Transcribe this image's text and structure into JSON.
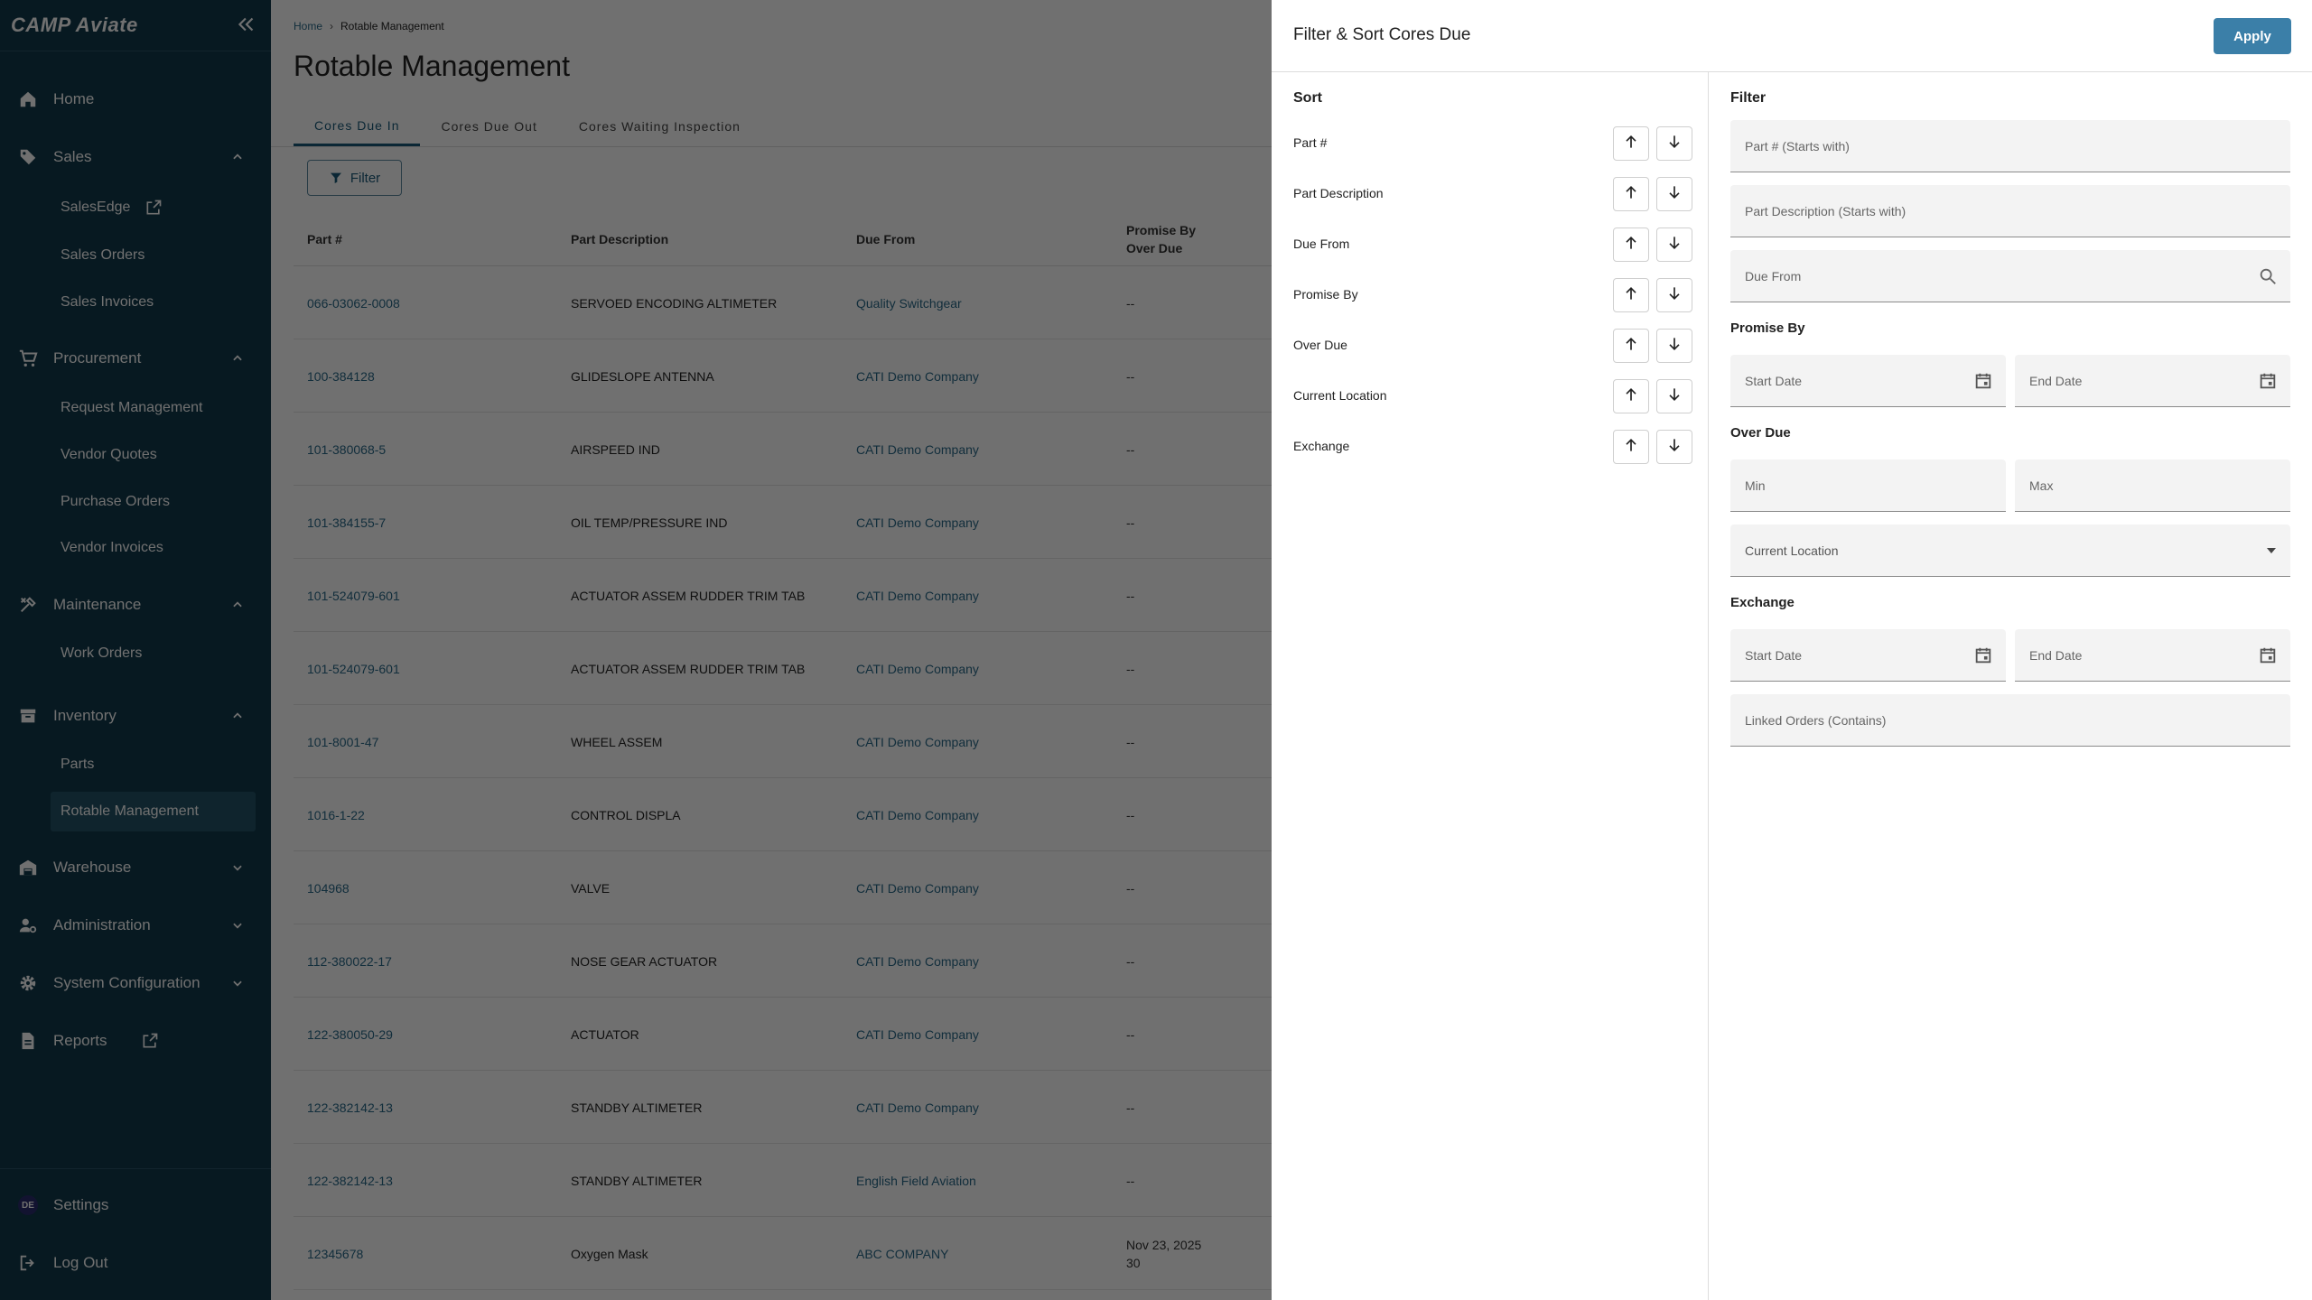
{
  "sidebar": {
    "logo": "CAMP Aviate",
    "nav": {
      "home": "Home",
      "sales": "Sales",
      "salesedge": "SalesEdge",
      "sales_orders": "Sales Orders",
      "sales_invoices": "Sales Invoices",
      "procurement": "Procurement",
      "request_management": "Request Management",
      "vendor_quotes": "Vendor Quotes",
      "purchase_orders": "Purchase Orders",
      "vendor_invoices": "Vendor Invoices",
      "maintenance": "Maintenance",
      "work_orders": "Work Orders",
      "inventory": "Inventory",
      "parts": "Parts",
      "rotable_management": "Rotable Management",
      "warehouse": "Warehouse",
      "administration": "Administration",
      "system_configuration": "System Configuration",
      "reports": "Reports"
    },
    "settings": "Settings",
    "avatar_initials": "DE",
    "logout": "Log Out"
  },
  "main": {
    "breadcrumb": {
      "home": "Home",
      "current": "Rotable Management"
    },
    "title": "Rotable Management",
    "tabs": [
      "Cores Due In",
      "Cores Due Out",
      "Cores Waiting Inspection"
    ],
    "filter_label": "Filter",
    "columns": {
      "part": "Part #",
      "desc": "Part Description",
      "due_from": "Due From",
      "promise_by": "Promise By",
      "over_due": "Over Due"
    },
    "rows": [
      {
        "part": "066-03062-0008",
        "desc": "SERVOED ENCODING ALTIMETER",
        "due_from": "Quality Switchgear",
        "promise": "--",
        "overdue": ""
      },
      {
        "part": "100-384128",
        "desc": "GLIDESLOPE ANTENNA",
        "due_from": "CATI Demo Company",
        "promise": "--",
        "overdue": ""
      },
      {
        "part": "101-380068-5",
        "desc": "AIRSPEED IND",
        "due_from": "CATI Demo Company",
        "promise": "--",
        "overdue": ""
      },
      {
        "part": "101-384155-7",
        "desc": "OIL TEMP/PRESSURE IND",
        "due_from": "CATI Demo Company",
        "promise": "--",
        "overdue": ""
      },
      {
        "part": "101-524079-601",
        "desc": "ACTUATOR ASSEM RUDDER TRIM TAB",
        "due_from": "CATI Demo Company",
        "promise": "--",
        "overdue": ""
      },
      {
        "part": "101-524079-601",
        "desc": "ACTUATOR ASSEM RUDDER TRIM TAB",
        "due_from": "CATI Demo Company",
        "promise": "--",
        "overdue": ""
      },
      {
        "part": "101-8001-47",
        "desc": "WHEEL ASSEM",
        "due_from": "CATI Demo Company",
        "promise": "--",
        "overdue": ""
      },
      {
        "part": "1016-1-22",
        "desc": "CONTROL DISPLA",
        "due_from": "CATI Demo Company",
        "promise": "--",
        "overdue": ""
      },
      {
        "part": "104968",
        "desc": "VALVE",
        "due_from": "CATI Demo Company",
        "promise": "--",
        "overdue": ""
      },
      {
        "part": "112-380022-17",
        "desc": "NOSE GEAR ACTUATOR",
        "due_from": "CATI Demo Company",
        "promise": "--",
        "overdue": ""
      },
      {
        "part": "122-380050-29",
        "desc": "ACTUATOR",
        "due_from": "CATI Demo Company",
        "promise": "--",
        "overdue": ""
      },
      {
        "part": "122-382142-13",
        "desc": "STANDBY ALTIMETER",
        "due_from": "CATI Demo Company",
        "promise": "--",
        "overdue": ""
      },
      {
        "part": "122-382142-13",
        "desc": "STANDBY ALTIMETER",
        "due_from": "English Field Aviation",
        "promise": "--",
        "overdue": ""
      },
      {
        "part": "12345678",
        "desc": "Oxygen Mask",
        "due_from": "ABC COMPANY",
        "promise": "Nov 23, 2025",
        "overdue": "30"
      }
    ]
  },
  "drawer": {
    "title": "Filter & Sort Cores Due",
    "apply": "Apply",
    "sort_title": "Sort",
    "sort_fields": [
      "Part #",
      "Part Description",
      "Due From",
      "Promise By",
      "Over Due",
      "Current Location",
      "Exchange"
    ],
    "filter_title": "Filter",
    "placeholders": {
      "part": "Part # (Starts with)",
      "desc": "Part Description (Starts with)",
      "due_from": "Due From",
      "start_date": "Start Date",
      "end_date": "End Date",
      "min": "Min",
      "max": "Max",
      "linked_orders": "Linked Orders (Contains)"
    },
    "current_location": "Current Location",
    "promise_by_title": "Promise By",
    "over_due_title": "Over Due",
    "exchange_title": "Exchange"
  },
  "colors": {
    "sidebar_bg": "#11394b",
    "accent": "#3b7fa8",
    "link": "#2a6a8a"
  },
  "icons": [
    "collapse-icon",
    "home-icon",
    "tag-icon",
    "cart-icon",
    "tools-icon",
    "archive-icon",
    "warehouse-icon",
    "admin-icon",
    "gear-icon",
    "document-icon",
    "external-link-icon",
    "logout-icon",
    "filter-icon",
    "arrow-up-icon",
    "arrow-down-icon",
    "search-icon",
    "calendar-icon",
    "caret-down-icon"
  ]
}
